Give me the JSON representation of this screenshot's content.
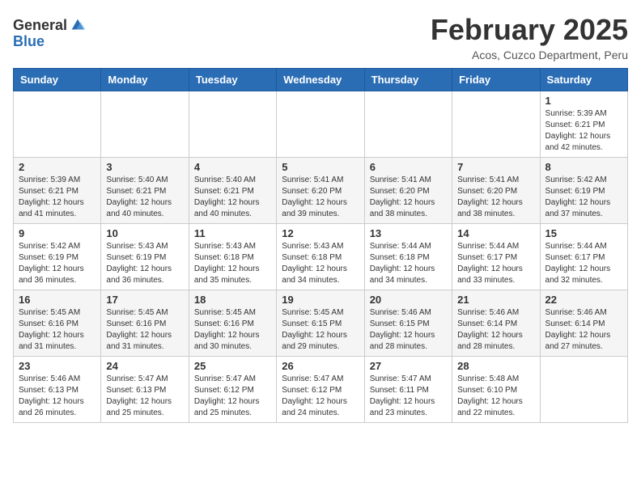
{
  "header": {
    "logo_general": "General",
    "logo_blue": "Blue",
    "month_title": "February 2025",
    "subtitle": "Acos, Cuzco Department, Peru"
  },
  "weekdays": [
    "Sunday",
    "Monday",
    "Tuesday",
    "Wednesday",
    "Thursday",
    "Friday",
    "Saturday"
  ],
  "weeks": [
    [
      {
        "day": "",
        "info": ""
      },
      {
        "day": "",
        "info": ""
      },
      {
        "day": "",
        "info": ""
      },
      {
        "day": "",
        "info": ""
      },
      {
        "day": "",
        "info": ""
      },
      {
        "day": "",
        "info": ""
      },
      {
        "day": "1",
        "info": "Sunrise: 5:39 AM\nSunset: 6:21 PM\nDaylight: 12 hours\nand 42 minutes."
      }
    ],
    [
      {
        "day": "2",
        "info": "Sunrise: 5:39 AM\nSunset: 6:21 PM\nDaylight: 12 hours\nand 41 minutes."
      },
      {
        "day": "3",
        "info": "Sunrise: 5:40 AM\nSunset: 6:21 PM\nDaylight: 12 hours\nand 40 minutes."
      },
      {
        "day": "4",
        "info": "Sunrise: 5:40 AM\nSunset: 6:21 PM\nDaylight: 12 hours\nand 40 minutes."
      },
      {
        "day": "5",
        "info": "Sunrise: 5:41 AM\nSunset: 6:20 PM\nDaylight: 12 hours\nand 39 minutes."
      },
      {
        "day": "6",
        "info": "Sunrise: 5:41 AM\nSunset: 6:20 PM\nDaylight: 12 hours\nand 38 minutes."
      },
      {
        "day": "7",
        "info": "Sunrise: 5:41 AM\nSunset: 6:20 PM\nDaylight: 12 hours\nand 38 minutes."
      },
      {
        "day": "8",
        "info": "Sunrise: 5:42 AM\nSunset: 6:19 PM\nDaylight: 12 hours\nand 37 minutes."
      }
    ],
    [
      {
        "day": "9",
        "info": "Sunrise: 5:42 AM\nSunset: 6:19 PM\nDaylight: 12 hours\nand 36 minutes."
      },
      {
        "day": "10",
        "info": "Sunrise: 5:43 AM\nSunset: 6:19 PM\nDaylight: 12 hours\nand 36 minutes."
      },
      {
        "day": "11",
        "info": "Sunrise: 5:43 AM\nSunset: 6:18 PM\nDaylight: 12 hours\nand 35 minutes."
      },
      {
        "day": "12",
        "info": "Sunrise: 5:43 AM\nSunset: 6:18 PM\nDaylight: 12 hours\nand 34 minutes."
      },
      {
        "day": "13",
        "info": "Sunrise: 5:44 AM\nSunset: 6:18 PM\nDaylight: 12 hours\nand 34 minutes."
      },
      {
        "day": "14",
        "info": "Sunrise: 5:44 AM\nSunset: 6:17 PM\nDaylight: 12 hours\nand 33 minutes."
      },
      {
        "day": "15",
        "info": "Sunrise: 5:44 AM\nSunset: 6:17 PM\nDaylight: 12 hours\nand 32 minutes."
      }
    ],
    [
      {
        "day": "16",
        "info": "Sunrise: 5:45 AM\nSunset: 6:16 PM\nDaylight: 12 hours\nand 31 minutes."
      },
      {
        "day": "17",
        "info": "Sunrise: 5:45 AM\nSunset: 6:16 PM\nDaylight: 12 hours\nand 31 minutes."
      },
      {
        "day": "18",
        "info": "Sunrise: 5:45 AM\nSunset: 6:16 PM\nDaylight: 12 hours\nand 30 minutes."
      },
      {
        "day": "19",
        "info": "Sunrise: 5:45 AM\nSunset: 6:15 PM\nDaylight: 12 hours\nand 29 minutes."
      },
      {
        "day": "20",
        "info": "Sunrise: 5:46 AM\nSunset: 6:15 PM\nDaylight: 12 hours\nand 28 minutes."
      },
      {
        "day": "21",
        "info": "Sunrise: 5:46 AM\nSunset: 6:14 PM\nDaylight: 12 hours\nand 28 minutes."
      },
      {
        "day": "22",
        "info": "Sunrise: 5:46 AM\nSunset: 6:14 PM\nDaylight: 12 hours\nand 27 minutes."
      }
    ],
    [
      {
        "day": "23",
        "info": "Sunrise: 5:46 AM\nSunset: 6:13 PM\nDaylight: 12 hours\nand 26 minutes."
      },
      {
        "day": "24",
        "info": "Sunrise: 5:47 AM\nSunset: 6:13 PM\nDaylight: 12 hours\nand 25 minutes."
      },
      {
        "day": "25",
        "info": "Sunrise: 5:47 AM\nSunset: 6:12 PM\nDaylight: 12 hours\nand 25 minutes."
      },
      {
        "day": "26",
        "info": "Sunrise: 5:47 AM\nSunset: 6:12 PM\nDaylight: 12 hours\nand 24 minutes."
      },
      {
        "day": "27",
        "info": "Sunrise: 5:47 AM\nSunset: 6:11 PM\nDaylight: 12 hours\nand 23 minutes."
      },
      {
        "day": "28",
        "info": "Sunrise: 5:48 AM\nSunset: 6:10 PM\nDaylight: 12 hours\nand 22 minutes."
      },
      {
        "day": "",
        "info": ""
      }
    ]
  ]
}
